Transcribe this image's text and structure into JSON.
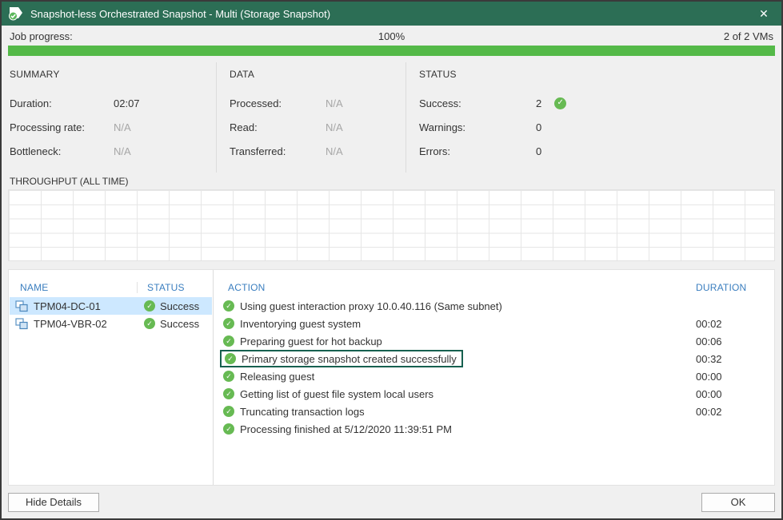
{
  "window": {
    "title": "Snapshot-less Orchestrated Snapshot - Multi (Storage Snapshot)",
    "close_glyph": "✕"
  },
  "progress": {
    "label": "Job progress:",
    "percent": "100%",
    "vm_count": "2 of 2 VMs",
    "value": 100
  },
  "summary": {
    "title": "SUMMARY",
    "rows": [
      {
        "label": "Duration:",
        "value": "02:07",
        "muted": false
      },
      {
        "label": "Processing rate:",
        "value": "N/A",
        "muted": true
      },
      {
        "label": "Bottleneck:",
        "value": "N/A",
        "muted": true
      }
    ]
  },
  "data_panel": {
    "title": "DATA",
    "rows": [
      {
        "label": "Processed:",
        "value": "N/A",
        "muted": true
      },
      {
        "label": "Read:",
        "value": "N/A",
        "muted": true
      },
      {
        "label": "Transferred:",
        "value": "N/A",
        "muted": true
      }
    ]
  },
  "status_panel": {
    "title": "STATUS",
    "rows": [
      {
        "label": "Success:",
        "value": "2",
        "icon": "success-check"
      },
      {
        "label": "Warnings:",
        "value": "0"
      },
      {
        "label": "Errors:",
        "value": "0"
      }
    ]
  },
  "throughput": {
    "title": "THROUGHPUT (ALL TIME)"
  },
  "vm_table": {
    "columns": {
      "name": "NAME",
      "status": "STATUS"
    },
    "rows": [
      {
        "name": "TPM04-DC-01",
        "status": "Success",
        "selected": true
      },
      {
        "name": "TPM04-VBR-02",
        "status": "Success",
        "selected": false
      }
    ]
  },
  "action_table": {
    "columns": {
      "action": "ACTION",
      "duration": "DURATION"
    },
    "rows": [
      {
        "action": "Using guest interaction proxy 10.0.40.116 (Same subnet)",
        "duration": ""
      },
      {
        "action": "Inventorying guest system",
        "duration": "00:02"
      },
      {
        "action": "Preparing guest for hot backup",
        "duration": "00:06"
      },
      {
        "action": "Primary storage snapshot created successfully",
        "duration": "00:32",
        "highlighted": true
      },
      {
        "action": "Releasing guest",
        "duration": "00:00"
      },
      {
        "action": "Getting list of guest file system local users",
        "duration": "00:00"
      },
      {
        "action": "Truncating transaction logs",
        "duration": "00:02"
      },
      {
        "action": "Processing finished at 5/12/2020 11:39:51 PM",
        "duration": ""
      }
    ]
  },
  "footer": {
    "hide_details_label": "Hide Details",
    "ok_label": "OK"
  },
  "icons": {
    "check_glyph": "✓"
  },
  "colors": {
    "titlebar_green": "#2c6e55",
    "progress_green": "#54b948",
    "column_header_blue": "#3a7ebf",
    "success_green": "#67ba53",
    "selected_row_blue": "#cde8ff",
    "highlight_border_green": "#16604f"
  }
}
